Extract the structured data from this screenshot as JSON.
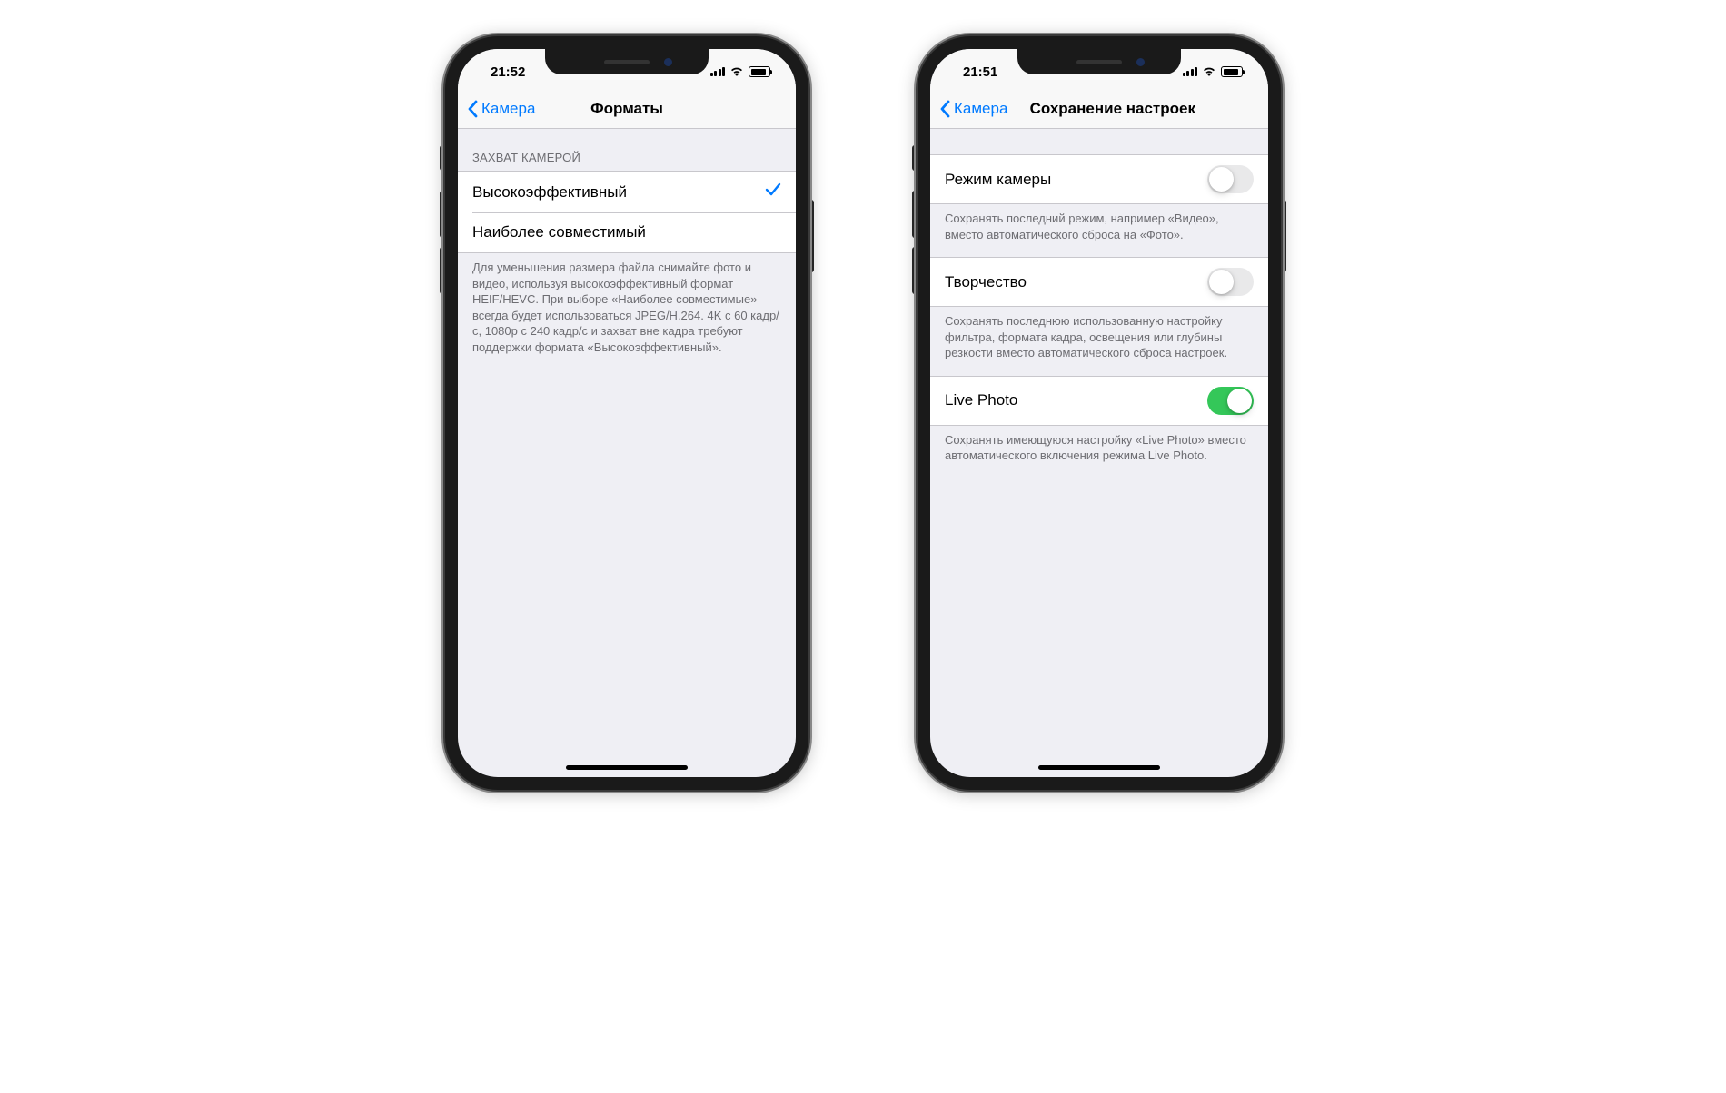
{
  "phone1": {
    "status": {
      "time": "21:52"
    },
    "nav": {
      "back_label": "Камера",
      "title": "Форматы"
    },
    "section_header": "ЗАХВАТ КАМЕРОЙ",
    "rows": [
      {
        "label": "Высокоэффективный",
        "checked": true
      },
      {
        "label": "Наиболее совместимый",
        "checked": false
      }
    ],
    "footer": "Для уменьшения размера файла снимайте фото и видео, используя высокоэффективный формат HEIF/HEVC. При выборе «Наиболее совместимые» всегда будет использоваться JPEG/H.264. 4K с 60 кадр/с, 1080p с 240 кадр/с и захват вне кадра требуют поддержки формата «Высокоэффективный»."
  },
  "phone2": {
    "status": {
      "time": "21:51"
    },
    "nav": {
      "back_label": "Камера",
      "title": "Сохранение настроек"
    },
    "groups": [
      {
        "label": "Режим камеры",
        "on": false,
        "footer": "Сохранять последний режим, например «Видео», вместо автоматического сброса на «Фото»."
      },
      {
        "label": "Творчество",
        "on": false,
        "footer": "Сохранять последнюю использованную настройку фильтра, формата кадра, освещения или глубины резкости вместо автоматического сброса настроек."
      },
      {
        "label": "Live Photo",
        "on": true,
        "footer": "Сохранять имеющуюся настройку «Live Photo» вместо автоматического включения режима Live Photo."
      }
    ]
  }
}
